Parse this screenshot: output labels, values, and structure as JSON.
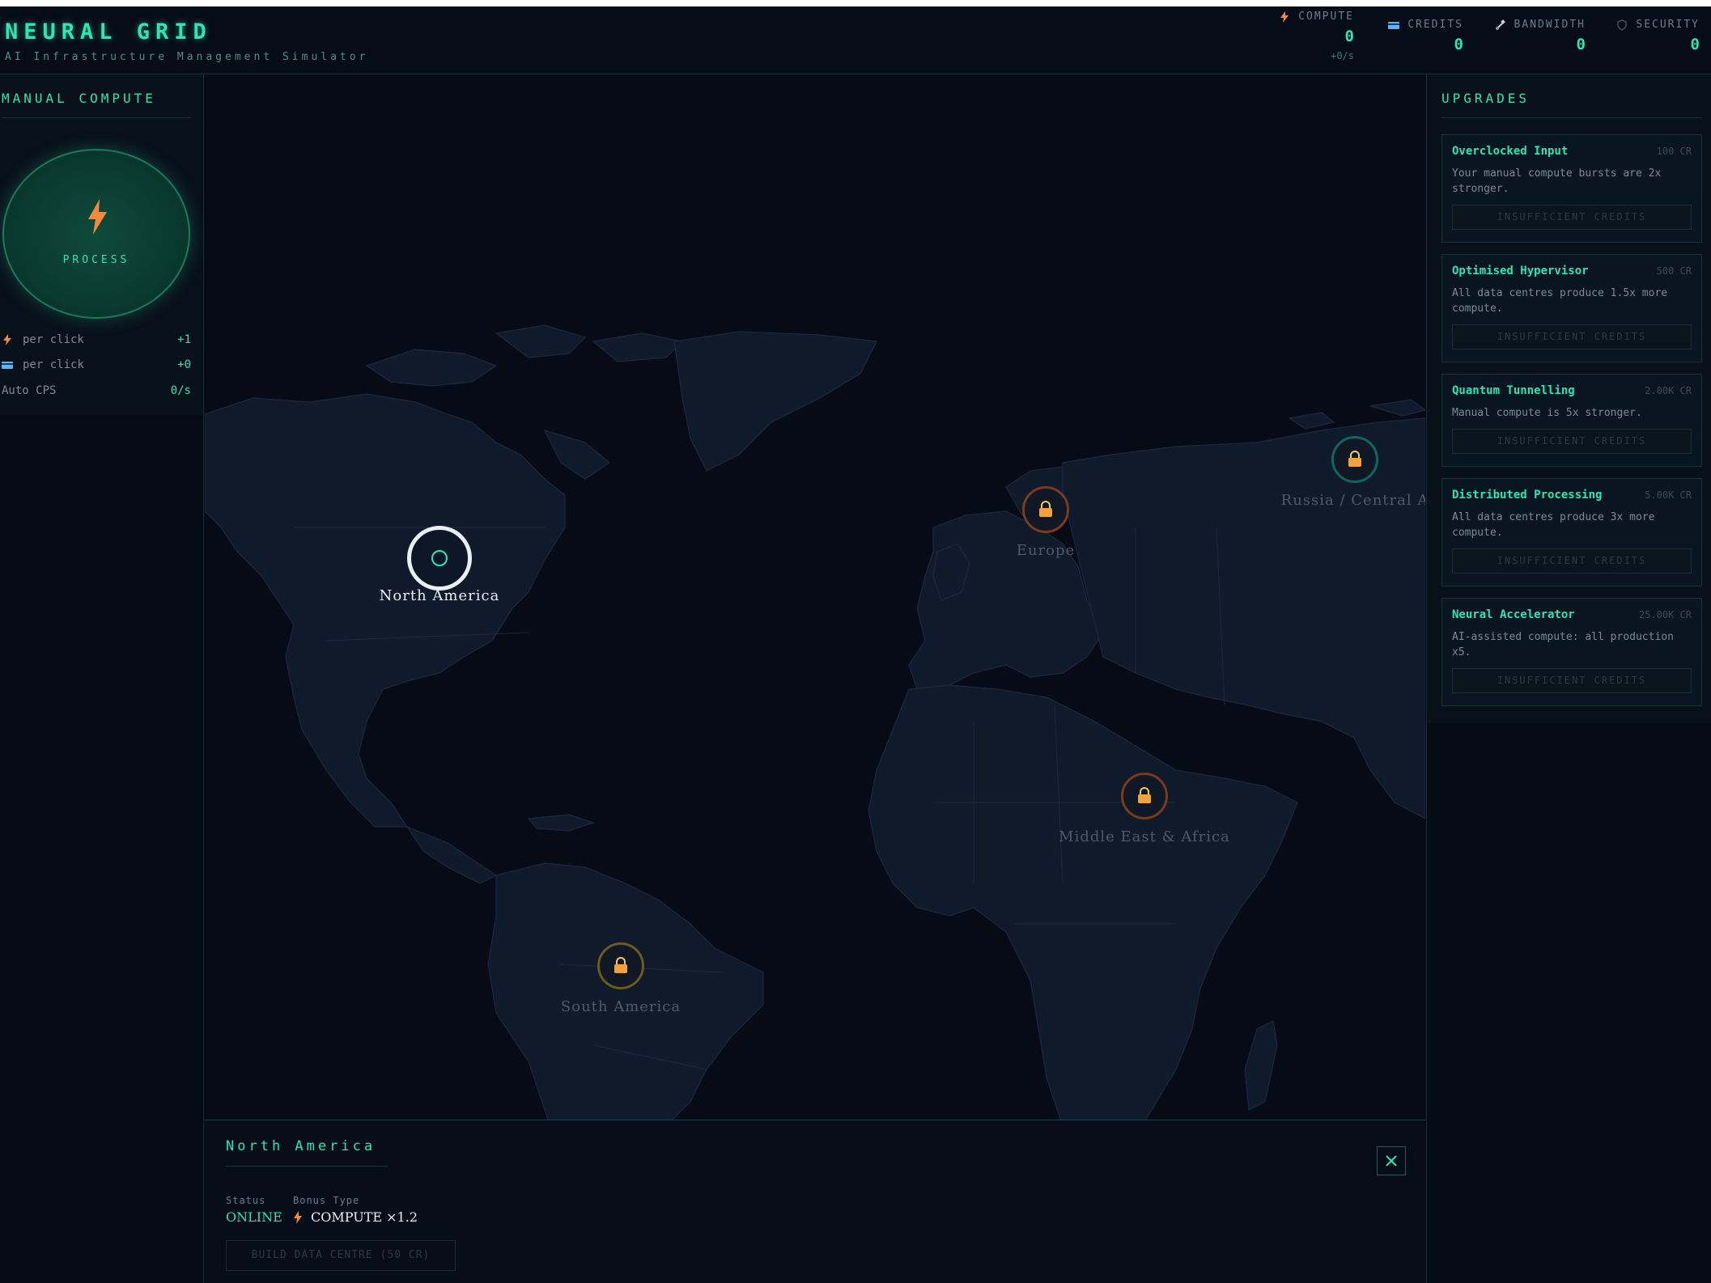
{
  "app": {
    "title": "NEURAL GRID",
    "subtitle": "AI Infrastructure Management Simulator"
  },
  "resources": [
    {
      "label": "COMPUTE",
      "value": "0",
      "rate": "+0/s",
      "icon": "bolt-icon",
      "color": "#f08a3c"
    },
    {
      "label": "CREDITS",
      "value": "0",
      "icon": "credit-card-icon",
      "color": "#59b3ff"
    },
    {
      "label": "BANDWIDTH",
      "value": "0",
      "icon": "satellite-icon",
      "color": "#c9d1d9"
    },
    {
      "label": "SECURITY",
      "value": "0",
      "icon": "shield-icon",
      "color": "#4a5560"
    }
  ],
  "manual": {
    "title": "MANUAL COMPUTE",
    "process_label": "PROCESS",
    "stats": [
      {
        "label": "per click",
        "value": "+1",
        "icon": "bolt-icon"
      },
      {
        "label": "per click",
        "value": "+0",
        "icon": "credit-card-icon"
      },
      {
        "label": "Auto CPS",
        "value": "0/s"
      }
    ]
  },
  "regions": [
    {
      "name": "North America",
      "state": "selected",
      "color": "#e8eef2"
    },
    {
      "name": "Europe",
      "state": "locked",
      "color": "#f08a3c"
    },
    {
      "name": "Russia / Central A",
      "state": "locked",
      "color": "#1fb5a0"
    },
    {
      "name": "Middle East & Africa",
      "state": "locked",
      "color": "#f08a3c"
    },
    {
      "name": "South America",
      "state": "locked",
      "color": "#c9a227"
    }
  ],
  "upgrades": {
    "title": "UPGRADES",
    "items": [
      {
        "name": "Overclocked Input",
        "cost": "100 CR",
        "desc": "Your manual compute bursts are 2x stronger.",
        "button": "INSUFFICIENT CREDITS"
      },
      {
        "name": "Optimised Hypervisor",
        "cost": "500 CR",
        "desc": "All data centres produce 1.5x more compute.",
        "button": "INSUFFICIENT CREDITS"
      },
      {
        "name": "Quantum Tunnelling",
        "cost": "2.00K CR",
        "desc": "Manual compute is 5x stronger.",
        "button": "INSUFFICIENT CREDITS"
      },
      {
        "name": "Distributed Processing",
        "cost": "5.00K CR",
        "desc": "All data centres produce 3x more compute.",
        "button": "INSUFFICIENT CREDITS"
      },
      {
        "name": "Neural Accelerator",
        "cost": "25.00K CR",
        "desc": "AI-assisted compute: all production x5.",
        "button": "INSUFFICIENT CREDITS"
      }
    ]
  },
  "detail": {
    "title": "North America",
    "status_label": "Status",
    "status_value": "ONLINE",
    "bonus_label": "Bonus Type",
    "bonus_value": "COMPUTE ×1.2",
    "build_button": "BUILD DATA CENTRE (50 CR)",
    "close_icon": "close-icon"
  },
  "colors": {
    "accent": "#2ee6b5",
    "compute": "#f08a3c",
    "credits": "#59b3ff",
    "land": "#0f1a2b",
    "ocean": "#060b16"
  }
}
